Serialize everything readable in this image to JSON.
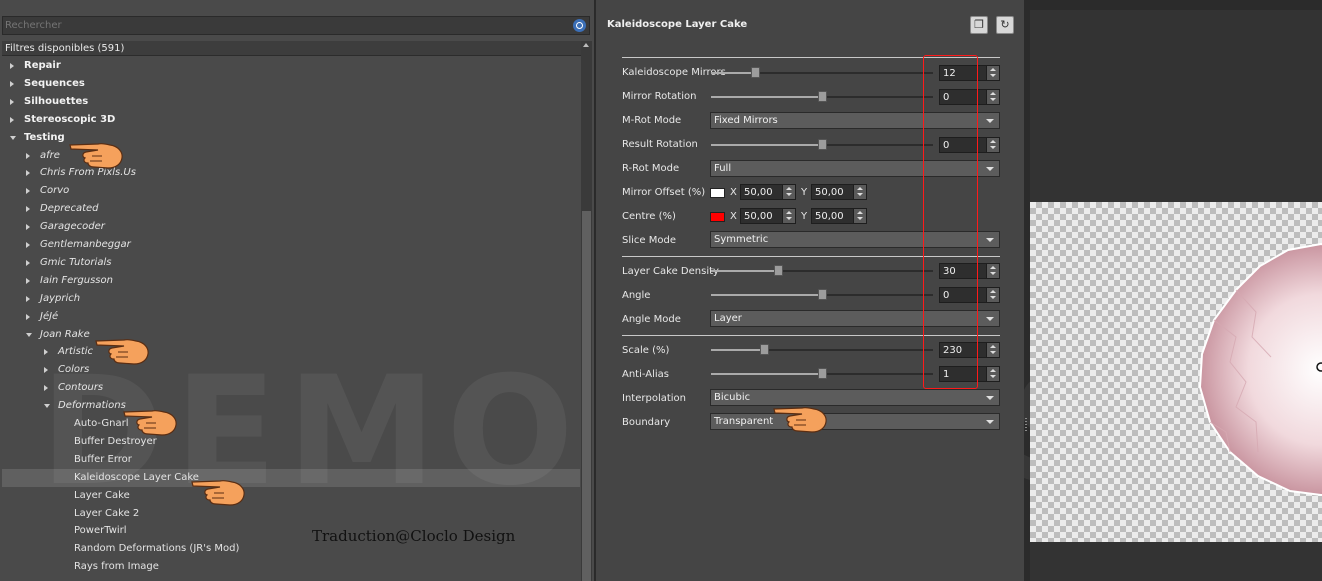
{
  "search": {
    "placeholder": "Rechercher"
  },
  "filters_header": "Filtres disponibles (591)",
  "tree": [
    {
      "label": "Repair",
      "level": 0,
      "arrow": "right"
    },
    {
      "label": "Sequences",
      "level": 0,
      "arrow": "right"
    },
    {
      "label": "Silhouettes",
      "level": 0,
      "arrow": "right"
    },
    {
      "label": "Stereoscopic 3D",
      "level": 0,
      "arrow": "right"
    },
    {
      "label": "Testing",
      "level": 0,
      "arrow": "down"
    },
    {
      "label": "afre",
      "level": 1,
      "arrow": "right"
    },
    {
      "label": "Chris From Pixls.Us",
      "level": 1,
      "arrow": "right"
    },
    {
      "label": "Corvo",
      "level": 1,
      "arrow": "right"
    },
    {
      "label": "Deprecated",
      "level": 1,
      "arrow": "right"
    },
    {
      "label": "Garagecoder",
      "level": 1,
      "arrow": "right"
    },
    {
      "label": "Gentlemanbeggar",
      "level": 1,
      "arrow": "right"
    },
    {
      "label": "Gmic Tutorials",
      "level": 1,
      "arrow": "right"
    },
    {
      "label": "Iain Fergusson",
      "level": 1,
      "arrow": "right"
    },
    {
      "label": "Jayprich",
      "level": 1,
      "arrow": "right"
    },
    {
      "label": "JéJé",
      "level": 1,
      "arrow": "right"
    },
    {
      "label": "Joan Rake",
      "level": 1,
      "arrow": "down"
    },
    {
      "label": "Artistic",
      "level": 2,
      "arrow": "right"
    },
    {
      "label": "Colors",
      "level": 2,
      "arrow": "right"
    },
    {
      "label": "Contours",
      "level": 2,
      "arrow": "right"
    },
    {
      "label": "Deformations",
      "level": 2,
      "arrow": "down"
    },
    {
      "label": "Auto-Gnarl",
      "level": 3,
      "arrow": "none"
    },
    {
      "label": "Buffer Destroyer",
      "level": 3,
      "arrow": "none"
    },
    {
      "label": "Buffer Error",
      "level": 3,
      "arrow": "none"
    },
    {
      "label": "Kaleidoscope Layer Cake",
      "level": 3,
      "arrow": "none",
      "selected": true
    },
    {
      "label": "Layer Cake",
      "level": 3,
      "arrow": "none"
    },
    {
      "label": "Layer Cake 2",
      "level": 3,
      "arrow": "none"
    },
    {
      "label": "PowerTwirl",
      "level": 3,
      "arrow": "none"
    },
    {
      "label": "Random Deformations (JR's Mod)",
      "level": 3,
      "arrow": "none"
    },
    {
      "label": "Rays from Image",
      "level": 3,
      "arrow": "none"
    }
  ],
  "watermark": "DEMO VERSION",
  "credit": "Traduction@Cloclo Design",
  "filter": {
    "title": "Kaleidoscope Layer Cake",
    "params": {
      "kaleidoscope_mirrors": {
        "label": "Kaleidoscope Mirrors",
        "value": "12",
        "level": 0.2
      },
      "mirror_rotation": {
        "label": "Mirror Rotation",
        "value": "0",
        "level": 0.5
      },
      "m_rot_mode": {
        "label": "M-Rot Mode",
        "value": "Fixed Mirrors"
      },
      "result_rotation": {
        "label": "Result Rotation",
        "value": "0",
        "level": 0.5
      },
      "r_rot_mode": {
        "label": "R-Rot Mode",
        "value": "Full"
      },
      "mirror_offset": {
        "label": "Mirror Offset (%)",
        "color": "#ffffff",
        "x_label": "X",
        "x": "50,00",
        "y_label": "Y",
        "y": "50,00"
      },
      "centre": {
        "label": "Centre (%)",
        "color": "#ff0000",
        "x_label": "X",
        "x": "50,00",
        "y_label": "Y",
        "y": "50,00"
      },
      "slice_mode": {
        "label": "Slice Mode",
        "value": "Symmetric"
      },
      "layer_cake_density": {
        "label": "Layer Cake Density",
        "value": "30",
        "level": 0.3
      },
      "angle": {
        "label": "Angle",
        "value": "0",
        "level": 0.5
      },
      "angle_mode": {
        "label": "Angle Mode",
        "value": "Layer"
      },
      "scale": {
        "label": "Scale (%)",
        "value": "230",
        "level": 0.24
      },
      "anti_alias": {
        "label": "Anti-Alias",
        "value": "1",
        "level": 0.5
      },
      "interpolation": {
        "label": "Interpolation",
        "value": "Bicubic"
      },
      "boundary": {
        "label": "Boundary",
        "value": "Transparent"
      }
    }
  },
  "colors": {
    "highlight_box": "#ff1a1a",
    "accent": "#3b6fb7"
  },
  "icons": [
    "search-icon",
    "copy-icon",
    "reset-icon",
    "pointing-hand-icon"
  ]
}
